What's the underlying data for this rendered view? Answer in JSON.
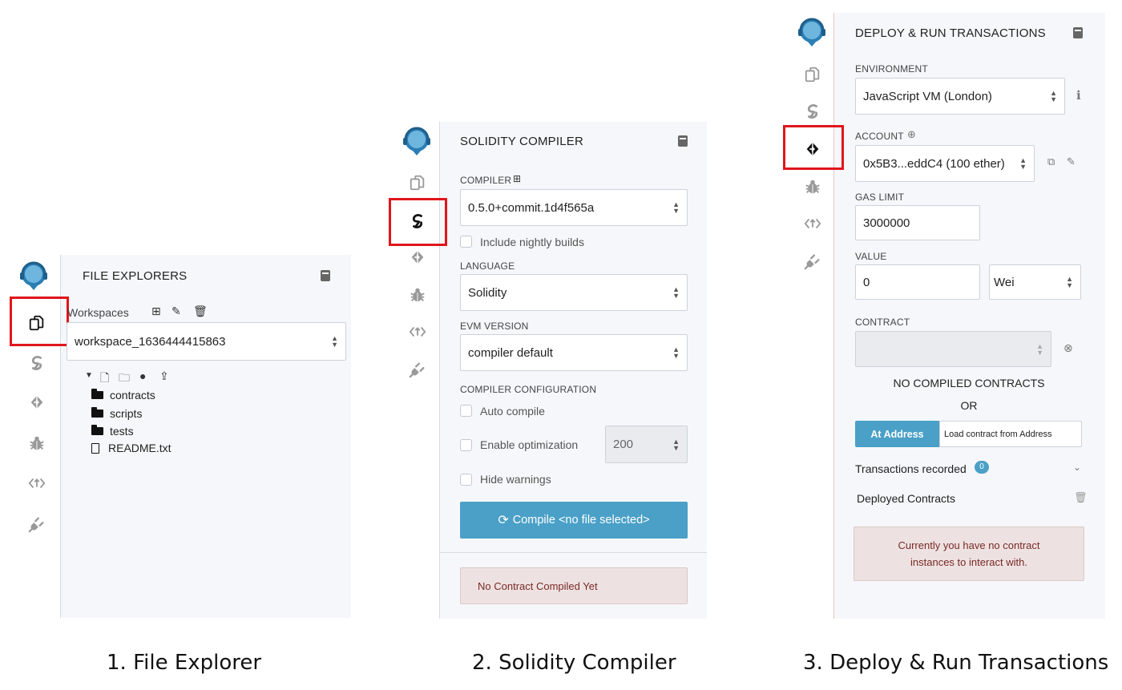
{
  "colors": {
    "accent": "#4aa0c7",
    "highlight": "#e0161b",
    "panel": "#f6f7fa",
    "alert_bg": "#ede2e1",
    "alert_text": "#7a2a26"
  },
  "panel1": {
    "title": "FILE EXPLORERS",
    "workspaces_label": "Workspaces",
    "workspace_value": "workspace_1636444415863",
    "tree": [
      {
        "type": "folder",
        "name": "contracts"
      },
      {
        "type": "folder",
        "name": "scripts"
      },
      {
        "type": "folder",
        "name": "tests"
      },
      {
        "type": "file",
        "name": "README.txt"
      }
    ],
    "caption": "1. File Explorer"
  },
  "panel2": {
    "title": "SOLIDITY COMPILER",
    "compiler_label": "COMPILER",
    "compiler_value": "0.5.0+commit.1d4f565a",
    "nightly_label": "Include nightly builds",
    "language_label": "LANGUAGE",
    "language_value": "Solidity",
    "evm_label": "EVM VERSION",
    "evm_value": "compiler default",
    "config_label": "COMPILER CONFIGURATION",
    "auto_compile": "Auto compile",
    "enable_optimization": "Enable optimization",
    "runs_value": "200",
    "hide_warnings": "Hide warnings",
    "compile_button": "Compile <no file selected>",
    "alert": "No Contract Compiled Yet",
    "caption": "2. Solidity Compiler"
  },
  "panel3": {
    "title": "DEPLOY & RUN TRANSACTIONS",
    "environment_label": "ENVIRONMENT",
    "environment_value": "JavaScript VM (London)",
    "account_label": "ACCOUNT",
    "account_value": "0x5B3...eddC4 (100 ether)",
    "gas_label": "GAS LIMIT",
    "gas_value": "3000000",
    "value_label": "VALUE",
    "value_amount": "0",
    "value_unit": "Wei",
    "contract_label": "CONTRACT",
    "no_compiled": "NO COMPILED CONTRACTS",
    "or": "OR",
    "at_address": "At Address",
    "load_address": "Load contract from Address",
    "transactions_recorded": "Transactions recorded",
    "transactions_count": "0",
    "deployed_contracts": "Deployed Contracts",
    "alert": "Currently you have no contract instances to interact with.",
    "caption": "3. Deploy & Run Transactions"
  }
}
